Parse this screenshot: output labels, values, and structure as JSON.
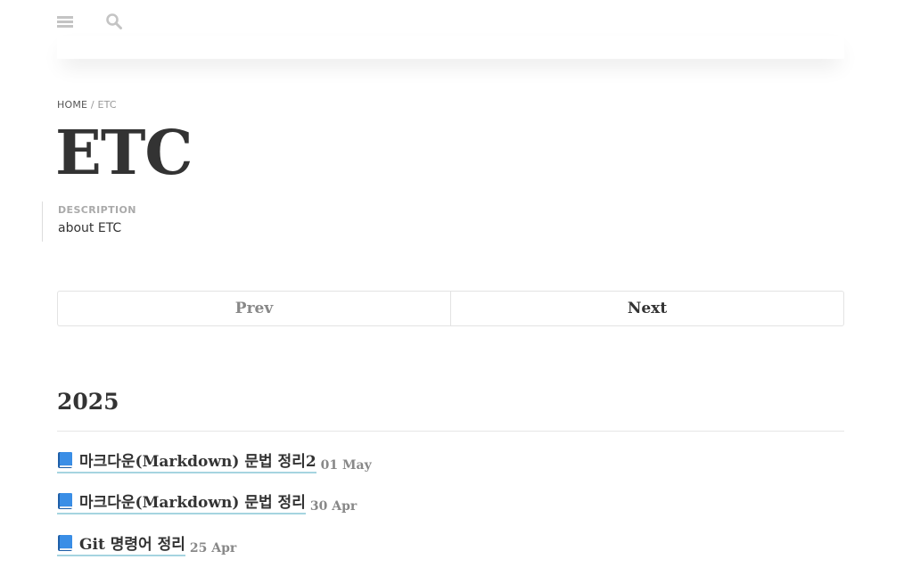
{
  "header": {
    "menu_icon": "menu-icon",
    "search_icon": "search-icon"
  },
  "breadcrumb": {
    "home": "HOME",
    "separator": "/",
    "current": "ETC"
  },
  "page": {
    "title": "ETC",
    "description_label": "DESCRIPTION",
    "description": "about ETC"
  },
  "pager": {
    "prev": "Prev",
    "next": "Next"
  },
  "archive": {
    "year": "2025",
    "posts": [
      {
        "icon": "book-icon",
        "title": "마크다운(Markdown) 문법 정리2",
        "date": "01 May"
      },
      {
        "icon": "book-icon",
        "title": "마크다운(Markdown) 문법 정리",
        "date": "30 Apr"
      },
      {
        "icon": "book-icon",
        "title": "Git 명령어 정리",
        "date": "25 Apr"
      }
    ]
  },
  "colors": {
    "text": "#333333",
    "muted": "#888888",
    "link_underline": "#a5d4e0",
    "book_blue": "#3a8ee6"
  }
}
